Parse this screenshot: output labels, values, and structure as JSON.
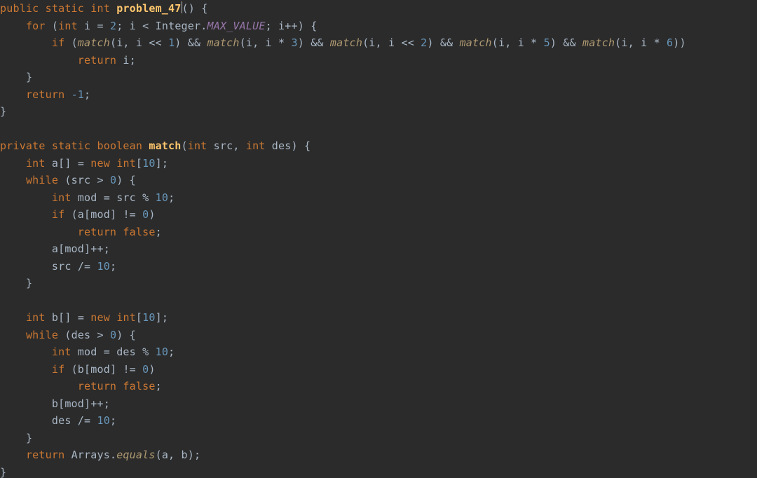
{
  "language": "java",
  "cursor": {
    "line": 1,
    "after_token_id": "m1_name"
  },
  "tokens": {
    "kw_public": "public",
    "kw_static": "static",
    "kw_int": "int",
    "kw_for": "for",
    "kw_if": "if",
    "kw_return": "return",
    "kw_private": "private",
    "kw_boolean": "boolean",
    "kw_new": "new",
    "kw_while": "while",
    "kw_false": "false",
    "m1_name": "problem_47",
    "m2_name": "match",
    "call_match": "match",
    "call_equals": "equals",
    "cls_Integer": "Integer",
    "cls_Arrays": "Arrays",
    "field_MAX_VALUE": "MAX_VALUE",
    "id_i": "i",
    "id_src": "src",
    "id_des": "des",
    "id_a": "a",
    "id_b": "b",
    "id_mod": "mod",
    "n_m1": "-1",
    "n_2": "2",
    "n_1": "1",
    "n_3": "3",
    "n_5": "5",
    "n_6": "6",
    "n_10": "10",
    "n_0": "0",
    "p_oparen": "(",
    "p_cparen": ")",
    "p_obrace": "{",
    "p_cbrace": "}",
    "p_obrack": "[",
    "p_cbrack": "]",
    "p_semi": ";",
    "p_comma": ",",
    "p_dot": ".",
    "op_assign": "=",
    "op_lt": "<",
    "op_inc": "++",
    "op_shl": "<<",
    "op_and": "&&",
    "op_mul": "*",
    "op_gt": ">",
    "op_mod": "%",
    "op_neq": "!=",
    "op_diveq": "/="
  },
  "code_plain": "public static int problem_47() {\n    for (int i = 2; i < Integer.MAX_VALUE; i++) {\n        if (match(i, i << 1) && match(i, i * 3) && match(i, i << 2) && match(i, i * 5) && match(i, i * 6))\n            return i;\n    }\n    return -1;\n}\n\nprivate static boolean match(int src, int des) {\n    int a[] = new int[10];\n    while (src > 0) {\n        int mod = src % 10;\n        if (a[mod] != 0)\n            return false;\n        a[mod]++;\n        src /= 10;\n    }\n\n    int b[] = new int[10];\n    while (des > 0) {\n        int mod = des % 10;\n        if (b[mod] != 0)\n            return false;\n        b[mod]++;\n        des /= 10;\n    }\n    return Arrays.equals(a, b);\n}"
}
